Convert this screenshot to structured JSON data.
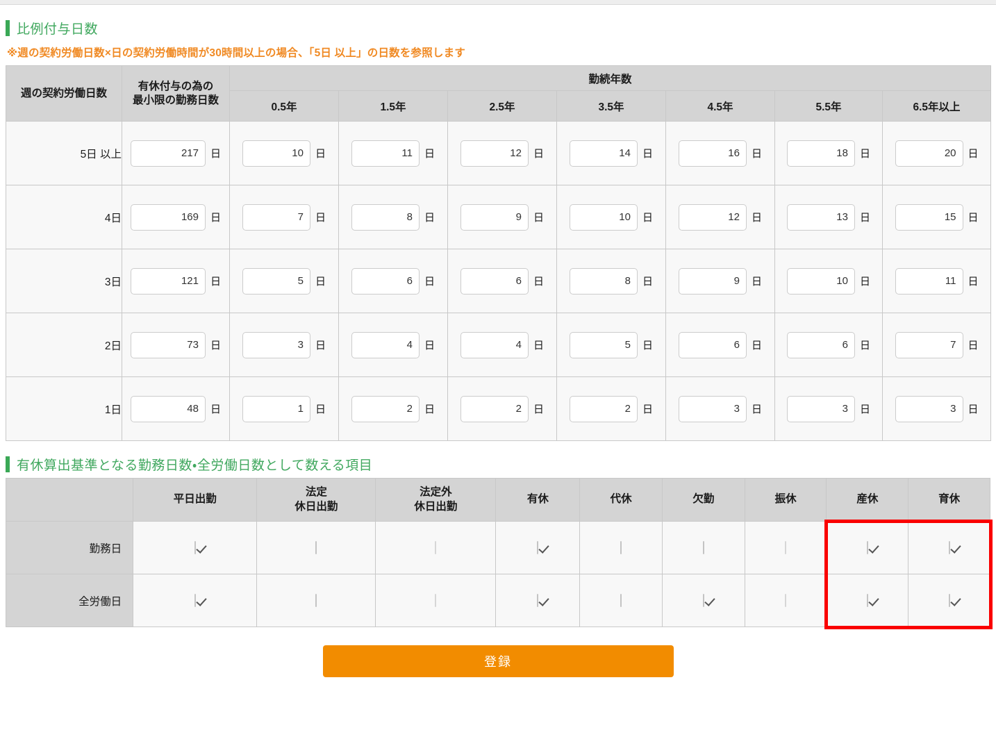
{
  "sections": {
    "proportional": {
      "title": "比例付与日数",
      "note": "※週の契約労働日数×日の契約労働時間が30時間以上の場合、「5日 以上」の日数を参照します",
      "headers": {
        "week_days": "週の契約労働日数",
        "min_work_days": "有休付与の為の\n最小限の勤務日数",
        "min_work_days_line1": "有休付与の為の",
        "min_work_days_line2": "最小限の勤務日数",
        "service_years_group": "勤続年数",
        "years": [
          "0.5年",
          "1.5年",
          "2.5年",
          "3.5年",
          "4.5年",
          "5.5年",
          "6.5年以上"
        ]
      },
      "unit": "日",
      "rows": [
        {
          "label": "5日 以上",
          "min_days": "217",
          "grants": [
            "10",
            "11",
            "12",
            "14",
            "16",
            "18",
            "20"
          ]
        },
        {
          "label": "4日",
          "min_days": "169",
          "grants": [
            "7",
            "8",
            "9",
            "10",
            "12",
            "13",
            "15"
          ]
        },
        {
          "label": "3日",
          "min_days": "121",
          "grants": [
            "5",
            "6",
            "6",
            "8",
            "9",
            "10",
            "11"
          ]
        },
        {
          "label": "2日",
          "min_days": "73",
          "grants": [
            "3",
            "4",
            "4",
            "5",
            "6",
            "6",
            "7"
          ]
        },
        {
          "label": "1日",
          "min_days": "48",
          "grants": [
            "1",
            "2",
            "2",
            "2",
            "3",
            "3",
            "3"
          ]
        }
      ]
    },
    "counting": {
      "title": "有休算出基準となる勤務日数・全労働日数として数える項目",
      "columns": [
        {
          "line1": "平日出勤",
          "line2": ""
        },
        {
          "line1": "法定",
          "line2": "休日出勤"
        },
        {
          "line1": "法定外",
          "line2": "休日出勤"
        },
        {
          "line1": "有休",
          "line2": ""
        },
        {
          "line1": "代休",
          "line2": ""
        },
        {
          "line1": "欠勤",
          "line2": ""
        },
        {
          "line1": "振休",
          "line2": ""
        },
        {
          "line1": "産休",
          "line2": ""
        },
        {
          "line1": "育休",
          "line2": ""
        }
      ],
      "rows": [
        {
          "label": "勤務日",
          "checks": [
            true,
            false,
            false,
            true,
            false,
            false,
            false,
            true,
            true
          ],
          "dim": [
            false,
            false,
            true,
            false,
            false,
            false,
            true,
            false,
            false
          ]
        },
        {
          "label": "全労働日",
          "checks": [
            true,
            false,
            false,
            true,
            false,
            true,
            false,
            true,
            true
          ],
          "dim": [
            false,
            false,
            true,
            false,
            false,
            false,
            true,
            false,
            false
          ]
        }
      ]
    }
  },
  "submit": {
    "label": "登録"
  },
  "colors": {
    "accent_green": "#41a85f",
    "note_orange": "#f08a24",
    "button_orange": "#f28c00",
    "annotation_red": "#fa0000",
    "header_grey": "#d4d4d4"
  }
}
